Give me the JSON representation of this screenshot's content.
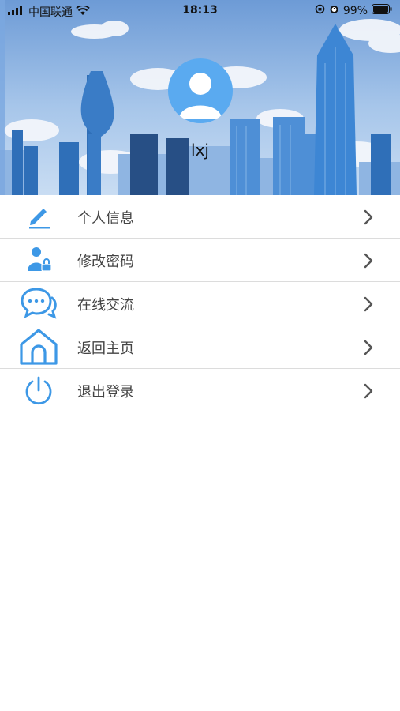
{
  "status_bar": {
    "carrier": "中国联通",
    "time": "18:13",
    "battery": "99%"
  },
  "profile": {
    "username": "lxj"
  },
  "menu": {
    "items": [
      {
        "label": "个人信息",
        "icon": "edit-icon"
      },
      {
        "label": "修改密码",
        "icon": "user-lock-icon"
      },
      {
        "label": "在线交流",
        "icon": "chat-icon"
      },
      {
        "label": "返回主页",
        "icon": "home-icon"
      },
      {
        "label": "退出登录",
        "icon": "power-icon"
      }
    ]
  },
  "colors": {
    "accent": "#3d98e6",
    "chevron": "#555555"
  }
}
